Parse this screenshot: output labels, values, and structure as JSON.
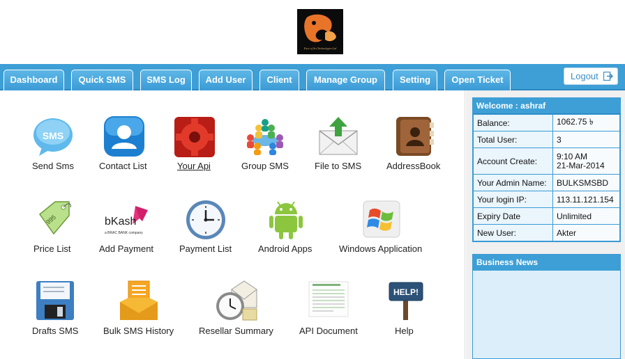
{
  "logo": {
    "text": "Face of Art Technologies Ltd"
  },
  "nav": {
    "tabs": [
      {
        "label": "Dashboard"
      },
      {
        "label": "Quick SMS"
      },
      {
        "label": "SMS Log"
      },
      {
        "label": "Add User"
      },
      {
        "label": "Client"
      },
      {
        "label": "Manage Group"
      },
      {
        "label": "Setting"
      },
      {
        "label": "Open Ticket"
      }
    ],
    "logout_label": "Logout"
  },
  "grid": {
    "items": [
      {
        "label": "Send Sms",
        "icon": "sms-bubble-icon"
      },
      {
        "label": "Contact List",
        "icon": "contact-person-icon"
      },
      {
        "label": "Your Api",
        "icon": "gear-icon"
      },
      {
        "label": "Group SMS",
        "icon": "group-people-icon"
      },
      {
        "label": "File to SMS",
        "icon": "envelope-upload-icon"
      },
      {
        "label": "AddressBook",
        "icon": "address-book-icon"
      },
      {
        "label": "Price List",
        "icon": "price-tag-icon"
      },
      {
        "label": "Add Payment",
        "icon": "bkash-logo-icon",
        "brand": "bKash",
        "brand_sub": "a BRAC BANK company"
      },
      {
        "label": "Payment List",
        "icon": "clock-icon"
      },
      {
        "label": "Android Apps",
        "icon": "android-icon"
      },
      {
        "label": "Windows Application",
        "icon": "windows-logo-icon"
      },
      {
        "label": "Drafts SMS",
        "icon": "floppy-disk-icon"
      },
      {
        "label": "Bulk SMS History",
        "icon": "inbox-tray-icon"
      },
      {
        "label": "Resellar Summary",
        "icon": "clock-envelope-icon"
      },
      {
        "label": "API Document",
        "icon": "document-icon"
      },
      {
        "label": "Help",
        "icon": "help-sign-icon",
        "sign_text": "HELP!"
      }
    ]
  },
  "info": {
    "title": "Welcome : ashraf",
    "rows": [
      {
        "label": "Balance:",
        "value": "1062.75 ৳"
      },
      {
        "label": "Total User:",
        "value": "3"
      },
      {
        "label": "Account Create:",
        "value": "9:10 AM",
        "value2": "21-Mar-2014"
      },
      {
        "label": "Your Admin Name:",
        "value": "BULKSMSBD"
      },
      {
        "label": "Your login IP:",
        "value": "113.11.121.154"
      },
      {
        "label": "Expiry Date",
        "value": "Unlimited"
      },
      {
        "label": "New User:",
        "value": "Akter"
      }
    ]
  },
  "news": {
    "title": "Business News"
  },
  "colors": {
    "accent": "#3d9fd6",
    "accent_dark": "#2b86bf",
    "panel_bg": "#dbeef9"
  }
}
